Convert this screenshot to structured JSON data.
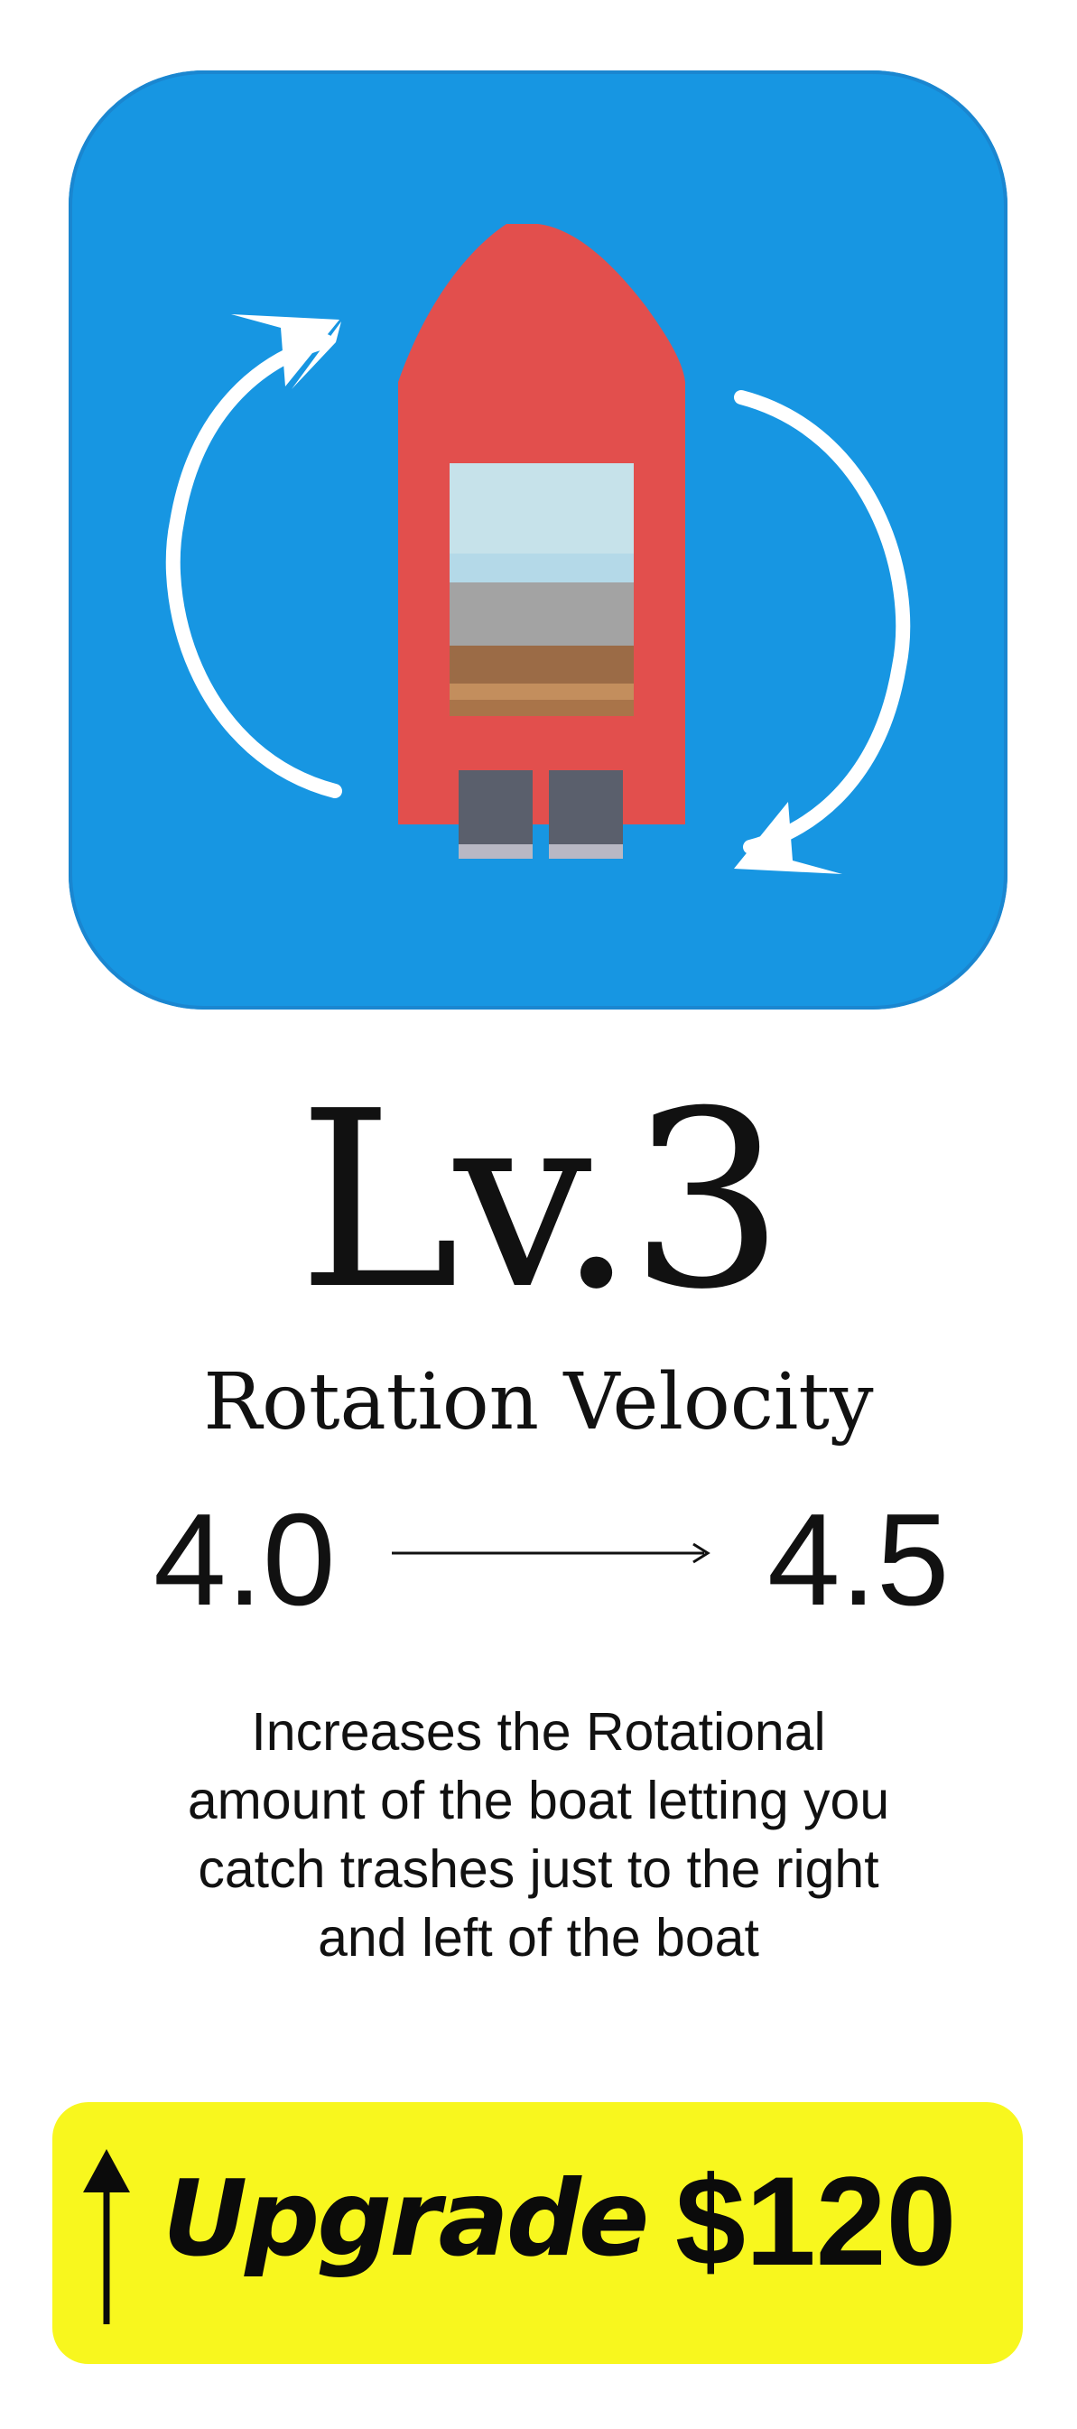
{
  "upgrade_card": {
    "icon": {
      "name": "rotating-boat-icon",
      "background_color": "#1796e2",
      "boat_color": "#e24f4d"
    },
    "level": "Lv.3",
    "stat": {
      "name": "Rotation Velocity",
      "current_value": "4.0",
      "next_value": "4.5"
    },
    "description": "Increases the Rotational\namount of the boat letting you\ncatch trashes just to the right\nand left of the boat",
    "button": {
      "label": "Upgrade",
      "price": "$120",
      "icon": "up-arrow-icon",
      "color": "#f8f71e"
    }
  }
}
